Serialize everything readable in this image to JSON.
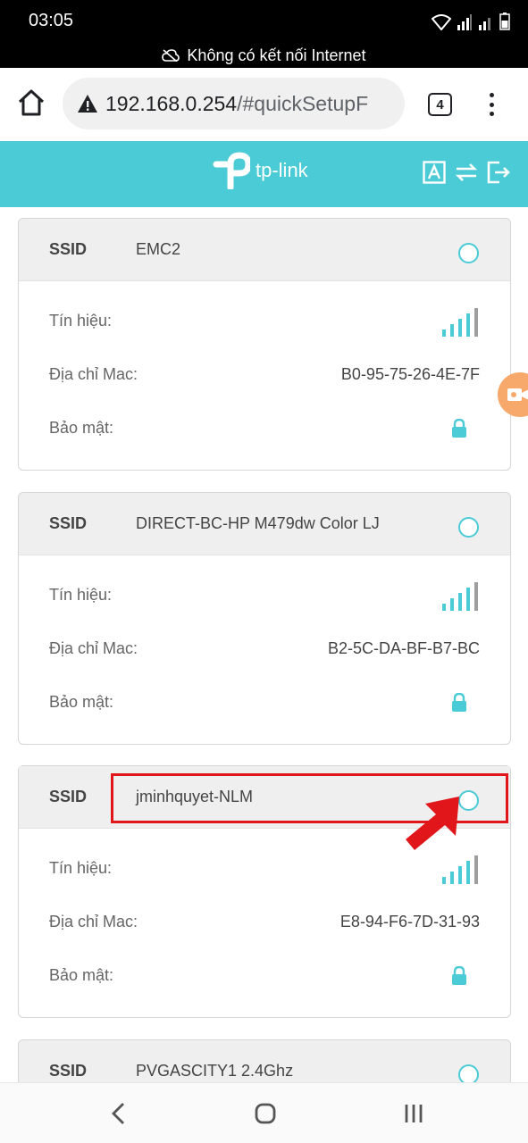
{
  "status_bar": {
    "time": "03:05",
    "notice": "Không có kết nối Internet"
  },
  "browser": {
    "url_host": "192.168.0.254",
    "url_path": "/#quickSetupF",
    "tab_count": "4"
  },
  "brand": {
    "logo_text": "tp-link",
    "accent_color": "#4acbd6"
  },
  "labels": {
    "ssid": "SSID",
    "signal": "Tín hiệu:",
    "mac": "Địa chỉ Mac:",
    "security": "Bảo mật:"
  },
  "networks": [
    {
      "ssid": "EMC2",
      "mac": "B0-95-75-26-4E-7F",
      "secured": true,
      "selected": false
    },
    {
      "ssid": "DIRECT-BC-HP M479dw Color LJ",
      "mac": "B2-5C-DA-BF-B7-BC",
      "secured": true,
      "selected": false
    },
    {
      "ssid": "jminhquyet-NLM",
      "mac": "E8-94-F6-7D-31-93",
      "secured": true,
      "selected": false,
      "highlighted": true
    },
    {
      "ssid": "PVGASCITY1 2.4Ghz",
      "selected": false
    }
  ],
  "icons": {
    "home": "home-icon",
    "warning": "warning-icon",
    "menu": "more-vert-icon",
    "signal": "signal-bars-icon",
    "lock": "lock-icon",
    "language": "language-icon",
    "switch": "switch-icon",
    "logout": "logout-icon",
    "back": "back-icon",
    "home_nav": "home-nav-icon",
    "recents": "recents-icon"
  },
  "annotation_color": "#e0161b"
}
